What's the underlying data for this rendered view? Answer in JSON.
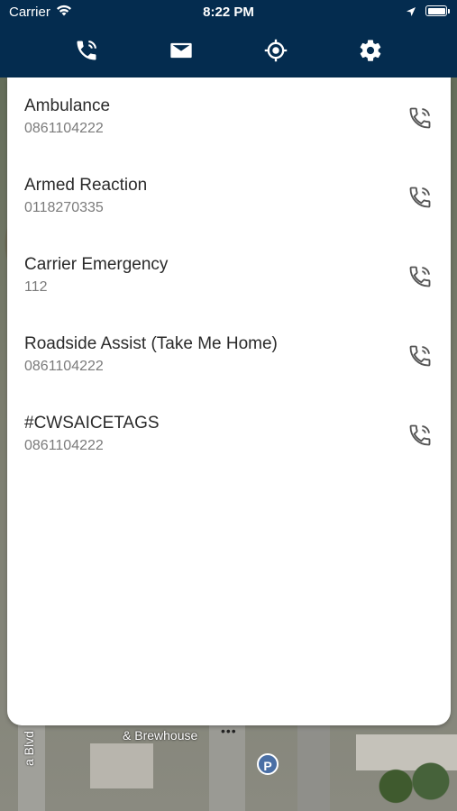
{
  "status_bar": {
    "carrier": "Carrier",
    "time": "8:22 PM"
  },
  "nav": {
    "items": [
      {
        "icon": "phone-call-icon",
        "active": true
      },
      {
        "icon": "mail-icon",
        "active": false
      },
      {
        "icon": "locate-icon",
        "active": false
      },
      {
        "icon": "gear-icon",
        "active": false
      }
    ],
    "icon_color": "#ffffff",
    "header_color": "#042c4f"
  },
  "contacts": [
    {
      "name": "Ambulance",
      "number": "0861104222"
    },
    {
      "name": "Armed Reaction",
      "number": "0118270335"
    },
    {
      "name": "Carrier Emergency",
      "number": "112"
    },
    {
      "name": "Roadside Assist (Take Me Home)",
      "number": "0861104222"
    },
    {
      "name": "#CWSAICETAGS",
      "number": "0861104222"
    }
  ],
  "map": {
    "place_label": "& Brewhouse",
    "street_label": "a Blvd",
    "parking_label": "P"
  }
}
